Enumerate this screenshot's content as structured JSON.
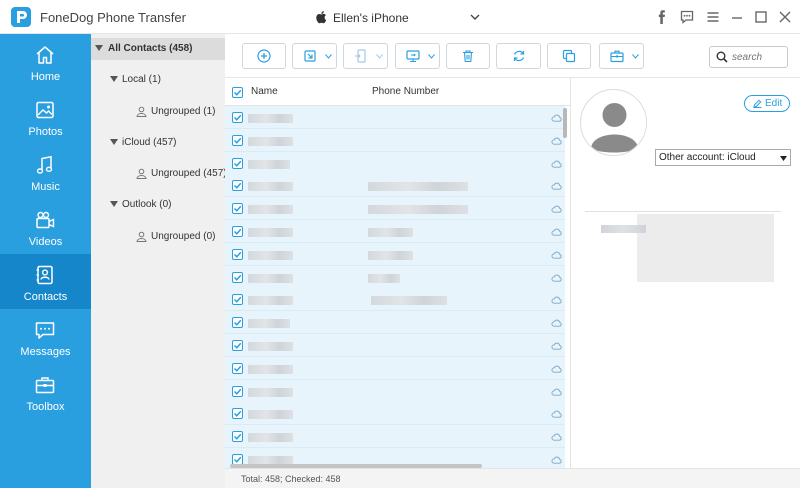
{
  "app": {
    "title": "FoneDog Phone Transfer"
  },
  "device": {
    "name": "Ellen's iPhone"
  },
  "nav": {
    "items": [
      {
        "label": "Home",
        "icon": "home-icon"
      },
      {
        "label": "Photos",
        "icon": "photos-icon"
      },
      {
        "label": "Music",
        "icon": "music-icon"
      },
      {
        "label": "Videos",
        "icon": "videos-icon"
      },
      {
        "label": "Contacts",
        "icon": "contacts-icon",
        "active": true
      },
      {
        "label": "Messages",
        "icon": "messages-icon"
      },
      {
        "label": "Toolbox",
        "icon": "toolbox-icon"
      }
    ]
  },
  "tree": {
    "all_contacts": "All Contacts  (458)",
    "local": "Local  (1)",
    "local_ungrouped": "Ungrouped  (1)",
    "icloud": "iCloud  (457)",
    "icloud_ungrouped": "Ungrouped  (457)",
    "outlook": "Outlook  (0)",
    "outlook_ungrouped": "Ungrouped  (0)"
  },
  "search": {
    "placeholder": "search"
  },
  "table": {
    "col_name": "Name",
    "col_phone": "Phone Number"
  },
  "status": {
    "text": "Total: 458; Checked: 458"
  },
  "details": {
    "edit_label": "Edit",
    "account": "Other account: iCloud"
  },
  "colors": {
    "nav_bg": "#2a9fe0",
    "nav_active": "#1586c9",
    "accent": "#2a9fe0",
    "row_bg": "#e8f4fb"
  }
}
